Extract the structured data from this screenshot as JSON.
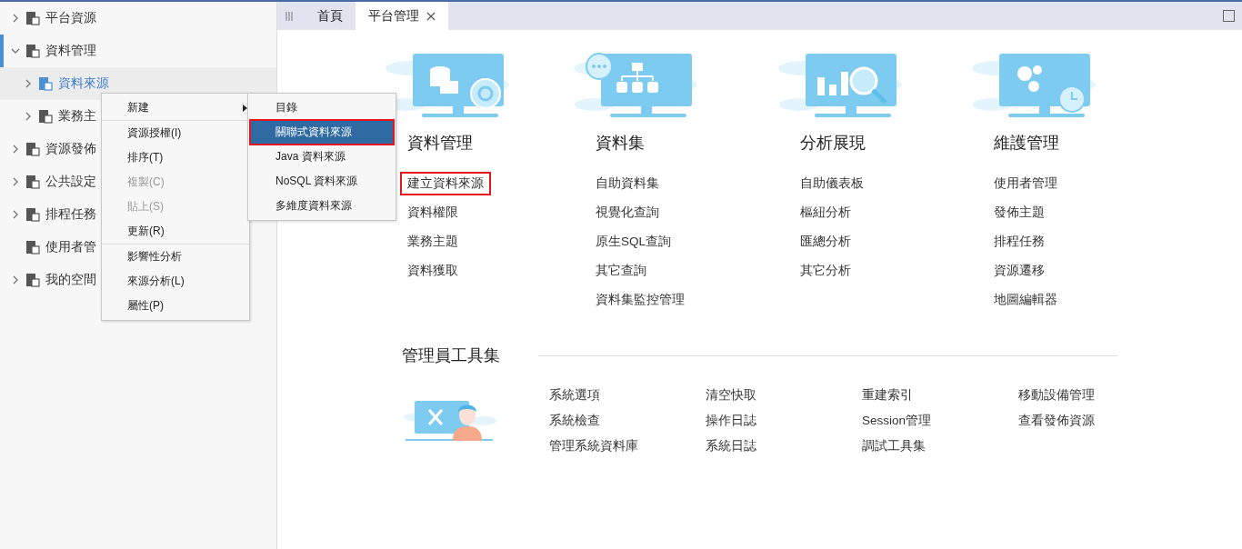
{
  "sidebar": {
    "items": [
      {
        "label": "平台資源",
        "expanded": false,
        "active": false
      },
      {
        "label": "資料管理",
        "expanded": true,
        "active": true,
        "children": [
          {
            "label": "資料來源",
            "selected": true
          },
          {
            "label": "業務主",
            "selected": false
          }
        ]
      },
      {
        "label": "資源發佈",
        "expanded": false,
        "active": false
      },
      {
        "label": "公共設定",
        "expanded": false,
        "active": false
      },
      {
        "label": "排程任務",
        "expanded": false,
        "active": false
      },
      {
        "label": "使用者管",
        "active": false
      },
      {
        "label": "我的空間",
        "expanded": false,
        "active": false
      }
    ]
  },
  "tabs": [
    {
      "label": "首頁",
      "selected": false,
      "closable": false
    },
    {
      "label": "平台管理",
      "selected": true,
      "closable": true
    }
  ],
  "context_menu": {
    "items": [
      {
        "label": "新建",
        "disabled": false,
        "submenu": true,
        "separator_after": true
      },
      {
        "label": "資源授權(I)",
        "disabled": false,
        "submenu": false,
        "separator_after": false
      },
      {
        "label": "排序(T)",
        "disabled": false,
        "submenu": false,
        "separator_after": false
      },
      {
        "label": "複製(C)",
        "disabled": true,
        "submenu": false,
        "separator_after": false
      },
      {
        "label": "貼上(S)",
        "disabled": true,
        "submenu": false,
        "separator_after": false
      },
      {
        "label": "更新(R)",
        "disabled": false,
        "submenu": false,
        "separator_after": true
      },
      {
        "label": "影響性分析",
        "disabled": false,
        "submenu": false,
        "separator_after": false
      },
      {
        "label": "來源分析(L)",
        "disabled": false,
        "submenu": false,
        "separator_after": false
      },
      {
        "label": "屬性(P)",
        "disabled": false,
        "submenu": false,
        "separator_after": false
      }
    ]
  },
  "submenu": {
    "items": [
      {
        "label": "目錄",
        "selected": false,
        "highlighted": false
      },
      {
        "label": "關聯式資料來源",
        "selected": true,
        "highlighted": true
      },
      {
        "label": "Java 資料來源",
        "selected": false,
        "highlighted": false
      },
      {
        "label": "NoSQL 資料來源",
        "selected": false,
        "highlighted": false
      },
      {
        "label": "多維度資料來源",
        "selected": false,
        "highlighted": false
      }
    ]
  },
  "sections": [
    {
      "kind": "database",
      "title": "資料管理",
      "links": [
        {
          "label": "建立資料來源",
          "highlighted": true
        },
        {
          "label": "資料權限",
          "highlighted": false
        },
        {
          "label": "業務主題",
          "highlighted": false
        },
        {
          "label": "資料獲取",
          "highlighted": false
        }
      ]
    },
    {
      "kind": "dataset",
      "title": "資料集",
      "links": [
        {
          "label": "自助資料集",
          "highlighted": false
        },
        {
          "label": "視覺化查詢",
          "highlighted": false
        },
        {
          "label": "原生SQL查詢",
          "highlighted": false
        },
        {
          "label": "其它查詢",
          "highlighted": false
        },
        {
          "label": "資料集監控管理",
          "highlighted": false
        }
      ]
    },
    {
      "kind": "analysis",
      "title": "分析展現",
      "links": [
        {
          "label": "自助儀表板",
          "highlighted": false
        },
        {
          "label": "樞紐分析",
          "highlighted": false
        },
        {
          "label": "匯總分析",
          "highlighted": false
        },
        {
          "label": "其它分析",
          "highlighted": false
        }
      ]
    },
    {
      "kind": "maintenance",
      "title": "維護管理",
      "links": [
        {
          "label": "使用者管理",
          "highlighted": false
        },
        {
          "label": "發佈主題",
          "highlighted": false
        },
        {
          "label": "排程任務",
          "highlighted": false
        },
        {
          "label": "資源遷移",
          "highlighted": false
        },
        {
          "label": "地圖編輯器",
          "highlighted": false
        }
      ]
    }
  ],
  "admin_tools": {
    "title": "管理員工具集",
    "items": [
      "系統選項",
      "清空快取",
      "重建索引",
      "移動設備管理",
      "系統檢查",
      "操作日誌",
      "Session管理",
      "查看發佈資源",
      "管理系統資料庫",
      "系統日誌",
      "調試工具集"
    ]
  }
}
